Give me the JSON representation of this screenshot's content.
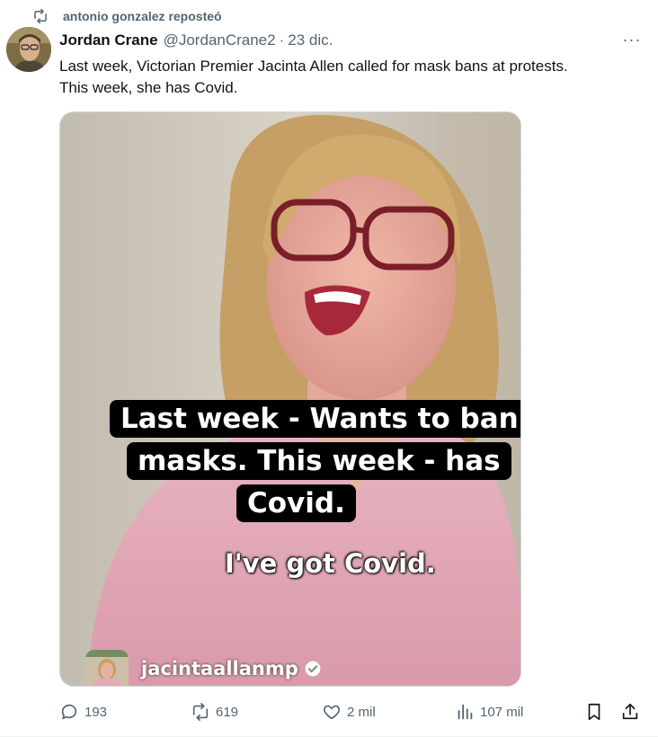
{
  "repost": {
    "icon": "repost-icon",
    "text": "antonio gonzalez reposteó"
  },
  "author": {
    "name": "Jordan Crane",
    "handle": "@JordanCrane2",
    "separator": "·",
    "date": "23 dic."
  },
  "more": {
    "icon": "more-icon",
    "label": "···"
  },
  "post": {
    "text_line1": "Last week, Victorian Premier Jacinta Allen called for mask bans at protests.",
    "text_line2": "This week, she has Covid."
  },
  "media": {
    "caption_line1": "Last week - Wants to ban",
    "caption_line2": "masks. This week - has",
    "caption_line3": "Covid.",
    "subtitle": "I've got Covid.",
    "watermark_name": "jacintaallanmp",
    "watermark_verified_icon": "verified-icon"
  },
  "actions": {
    "replies": "193",
    "reposts": "619",
    "likes": "2 mil",
    "views": "107 mil"
  },
  "colors": {
    "text": "#0f1419",
    "muted": "#536471",
    "border": "#cfd9de",
    "shirt": "#e4a9b7",
    "hair": "#caa468"
  }
}
